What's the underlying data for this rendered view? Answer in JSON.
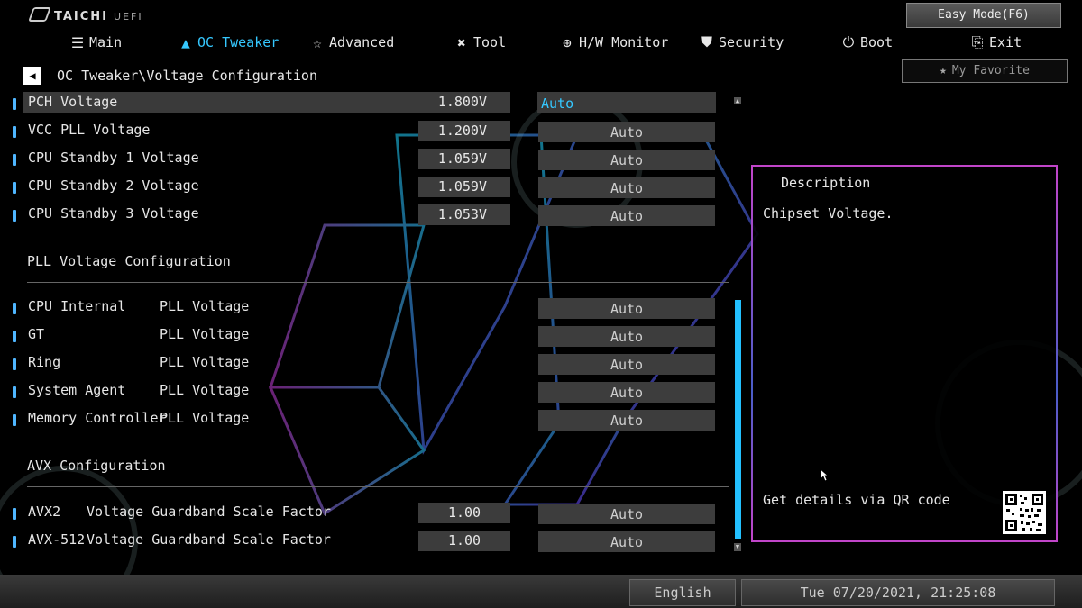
{
  "brand": {
    "name": "TAICHI",
    "sub": "UEFI"
  },
  "header": {
    "easy_mode": "Easy Mode(F6)",
    "my_favorite": "My Favorite",
    "nav": [
      {
        "label": "Main",
        "icon": "list-icon",
        "active": false
      },
      {
        "label": "OC Tweaker",
        "icon": "rocket-icon",
        "active": true
      },
      {
        "label": "Advanced",
        "icon": "star-icon",
        "active": false
      },
      {
        "label": "Tool",
        "icon": "wrench-icon",
        "active": false
      },
      {
        "label": "H/W Monitor",
        "icon": "gauge-icon",
        "active": false
      },
      {
        "label": "Security",
        "icon": "shield-icon",
        "active": false
      },
      {
        "label": "Boot",
        "icon": "power-icon",
        "active": false
      },
      {
        "label": "Exit",
        "icon": "exit-icon",
        "active": false
      }
    ]
  },
  "breadcrumb": "OC Tweaker\\Voltage Configuration",
  "voltage_rows": [
    {
      "label": "PCH Voltage",
      "value": "1.800V",
      "option": "Auto",
      "selected": true
    },
    {
      "label": "VCC PLL Voltage",
      "value": "1.200V",
      "option": "Auto",
      "selected": false
    },
    {
      "label": "CPU Standby 1 Voltage",
      "value": "1.059V",
      "option": "Auto",
      "selected": false
    },
    {
      "label": "CPU Standby 2 Voltage",
      "value": "1.059V",
      "option": "Auto",
      "selected": false
    },
    {
      "label": "CPU Standby 3 Voltage",
      "value": "1.053V",
      "option": "Auto",
      "selected": false
    }
  ],
  "pll_section": {
    "title": "PLL Voltage Configuration",
    "rows": [
      {
        "label": "CPU Internal",
        "suffix": "PLL Voltage",
        "option": "Auto"
      },
      {
        "label": "GT",
        "suffix": "PLL Voltage",
        "option": "Auto"
      },
      {
        "label": "Ring",
        "suffix": "PLL Voltage",
        "option": "Auto"
      },
      {
        "label": "System Agent",
        "suffix": "PLL Voltage",
        "option": "Auto"
      },
      {
        "label": "Memory Controller",
        "suffix": "PLL Voltage",
        "option": "Auto"
      }
    ]
  },
  "avx_section": {
    "title": "AVX Configuration",
    "rows": [
      {
        "label": "AVX2",
        "suffix": "Voltage Guardband Scale Factor",
        "value": "1.00",
        "option": "Auto"
      },
      {
        "label": "AVX-512",
        "suffix": "Voltage Guardband Scale Factor",
        "value": "1.00",
        "option": "Auto"
      }
    ]
  },
  "description": {
    "title": "Description",
    "text": "Chipset Voltage.",
    "qr_label": "Get details via QR code"
  },
  "footer": {
    "language": "English",
    "datetime": "Tue 07/20/2021, 21:25:08"
  },
  "colors": {
    "accent": "#35c8ff",
    "scrollbar": "#23c0ff",
    "panel_border": "#c145c9"
  }
}
